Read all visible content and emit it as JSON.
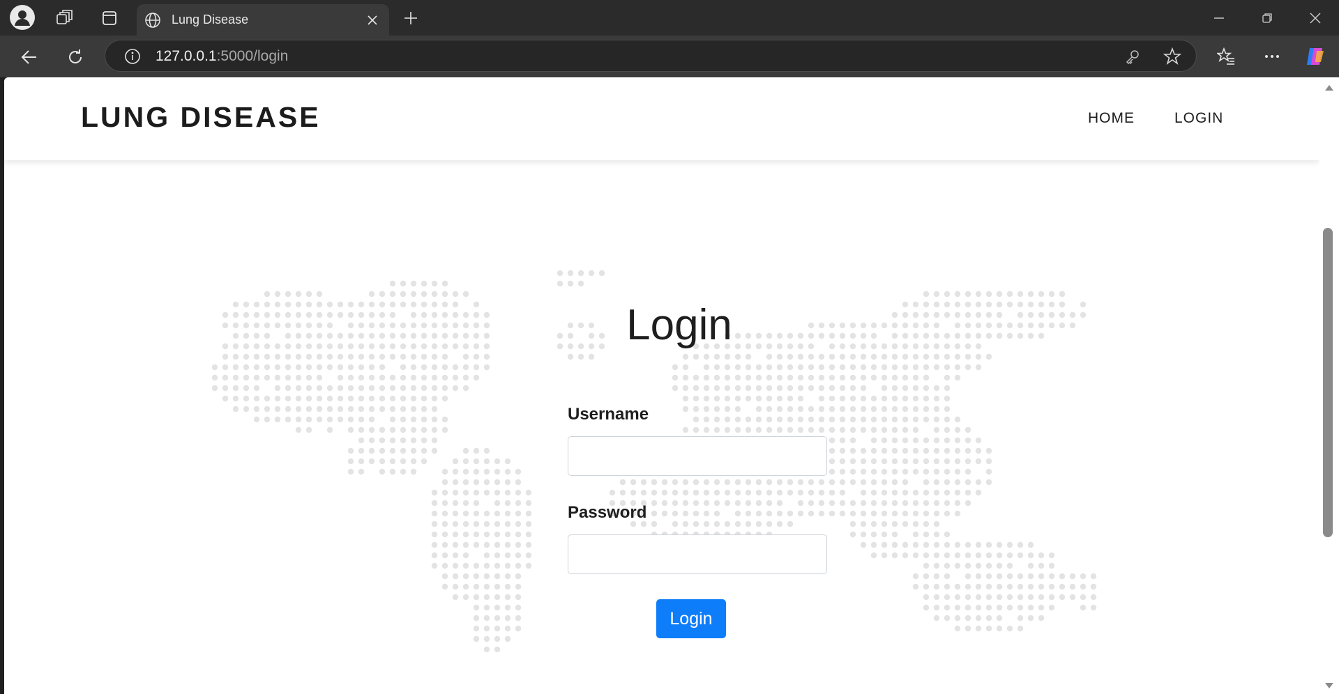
{
  "browser": {
    "tab_title": "Lung Disease",
    "url_host": "127.0.0.1",
    "url_rest": ":5000/login"
  },
  "navbar": {
    "brand": "LUNG DISEASE",
    "links": [
      "HOME",
      "LOGIN"
    ]
  },
  "login": {
    "title": "Login",
    "username_label": "Username",
    "username_value": "",
    "password_label": "Password",
    "password_value": "",
    "submit_label": "Login"
  },
  "colors": {
    "primary": "#0d7dfa",
    "map_dots": "#e3e3e3",
    "text": "#1e1e1e"
  }
}
